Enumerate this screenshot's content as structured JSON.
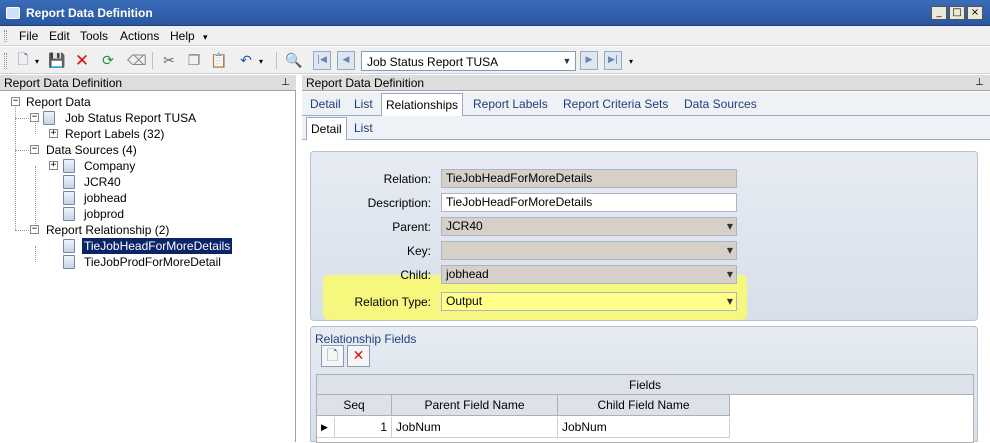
{
  "window": {
    "title": "Report Data Definition",
    "controls": [
      "_",
      "□",
      "×"
    ]
  },
  "menu": [
    "File",
    "Edit",
    "Tools",
    "Actions",
    "Help"
  ],
  "toolbar": {
    "report_selector": "Job Status Report TUSA",
    "icons": [
      "new-icon",
      "save-icon",
      "delete-icon",
      "refresh-icon",
      "eraser-icon",
      "cut-icon",
      "copy-icon",
      "paste-icon",
      "undo-icon",
      "search-icon"
    ]
  },
  "left_panel": {
    "title": "Report Data Definition",
    "tree": {
      "root": "Report Data",
      "report": "Job Status Report TUSA",
      "report_labels": "Report Labels (32)",
      "data_sources": "Data Sources (4)",
      "data_source_items": [
        "Company",
        "JCR40",
        "jobhead",
        "jobprod"
      ],
      "report_relationship": "Report Relationship (2)",
      "relationship_items": [
        "TieJobHeadForMoreDetails",
        "TieJobProdForMoreDetail"
      ]
    }
  },
  "right_panel": {
    "title": "Report Data Definition",
    "tabs": [
      "Detail",
      "List",
      "Relationships",
      "Report Labels",
      "Report Criteria Sets",
      "Data Sources"
    ],
    "subtabs": [
      "Detail",
      "List"
    ],
    "form": {
      "relation_label": "Relation:",
      "relation_value": "TieJobHeadForMoreDetails",
      "description_label": "Description:",
      "description_value": "TieJobHeadForMoreDetails",
      "parent_label": "Parent:",
      "parent_value": "JCR40",
      "key_label": "Key:",
      "key_value": "",
      "child_label": "Child:",
      "child_value": "jobhead",
      "relation_type_label": "Relation Type:",
      "relation_type_value": "Output"
    },
    "relationship_fields": {
      "title": "Relationship Fields",
      "grid_caption": "Fields",
      "columns": [
        "Seq",
        "Parent Field Name",
        "Child Field Name"
      ],
      "rows": [
        {
          "seq": "1",
          "parent": "JobNum",
          "child": "JobNum"
        }
      ]
    }
  },
  "colors": {
    "title_bar": "#2a57a0",
    "selection": "#0a246a",
    "highlight": "#ffff5a"
  }
}
